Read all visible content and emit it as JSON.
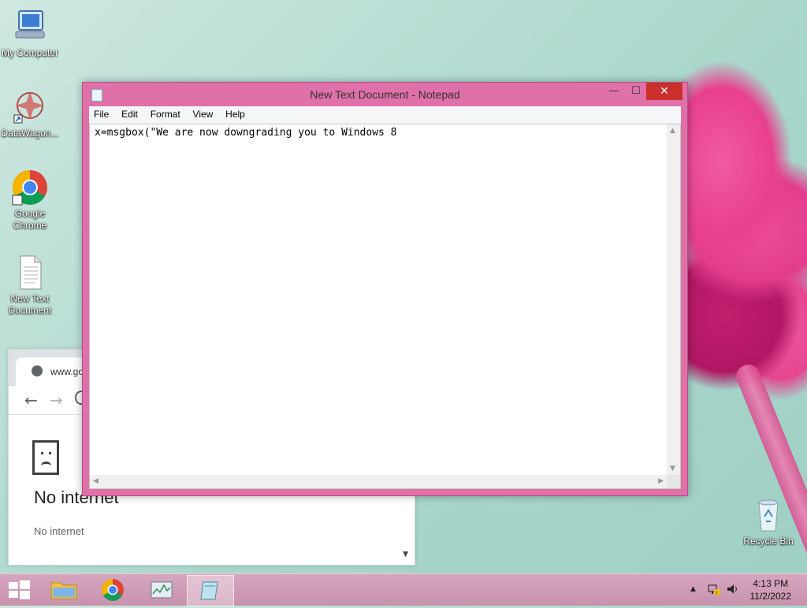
{
  "desktop": {
    "icons": [
      {
        "label": "My Computer",
        "icon": "computer-icon"
      },
      {
        "label": "DataWagon...",
        "icon": "datawagon-icon"
      },
      {
        "label": "Google Chrome",
        "icon": "chrome-icon"
      },
      {
        "label": "New Text Document",
        "icon": "text-document-icon"
      },
      {
        "label": "Recycle Bin",
        "icon": "recycle-bin-icon"
      }
    ]
  },
  "chrome": {
    "tab_url": "www.go",
    "nav": {
      "back": "←",
      "forward": "→"
    },
    "error_title": "No internet",
    "error_subtitle": "No internet"
  },
  "notepad": {
    "title": "New Text Document - Notepad",
    "menu": [
      "File",
      "Edit",
      "Format",
      "View",
      "Help"
    ],
    "content": "x=msgbox(\"We are now downgrading you to Windows 8",
    "buttons": {
      "minimize": "—",
      "maximize": "☐",
      "close": "✕"
    }
  },
  "taskbar": {
    "items": [
      "start-button",
      "file-explorer",
      "google-chrome",
      "task-manager",
      "notepad"
    ],
    "clock_time": "4:13 PM",
    "clock_date": "11/2/2022",
    "tray_chevron": "▲"
  }
}
